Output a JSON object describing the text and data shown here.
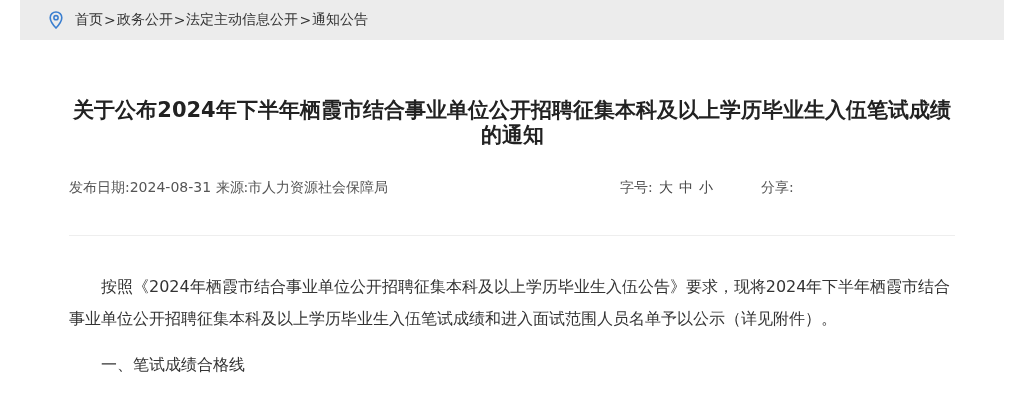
{
  "breadcrumb": {
    "items": [
      "首页",
      "政务公开",
      "法定主动信息公开",
      "通知公告"
    ],
    "separator": ">"
  },
  "article": {
    "title": "关于公布2024年下半年栖霞市结合事业单位公开招聘征集本科及以上学历毕业生入伍笔试成绩的通知",
    "meta": "发布日期:2024-08-31 来源:市人力资源社会保障局",
    "font_size": {
      "label": "字号:",
      "options": [
        "大",
        "中",
        "小"
      ]
    },
    "share": {
      "label": "分享:"
    },
    "paragraphs": [
      "按照《2024年栖霞市结合事业单位公开招聘征集本科及以上学历毕业生入伍公告》要求，现将2024年下半年栖霞市结合事业单位公开招聘征集本科及以上学历毕业生入伍笔试成绩和进入面试范围人员名单予以公示（详见附件）。",
      "一、笔试成绩合格线"
    ]
  }
}
